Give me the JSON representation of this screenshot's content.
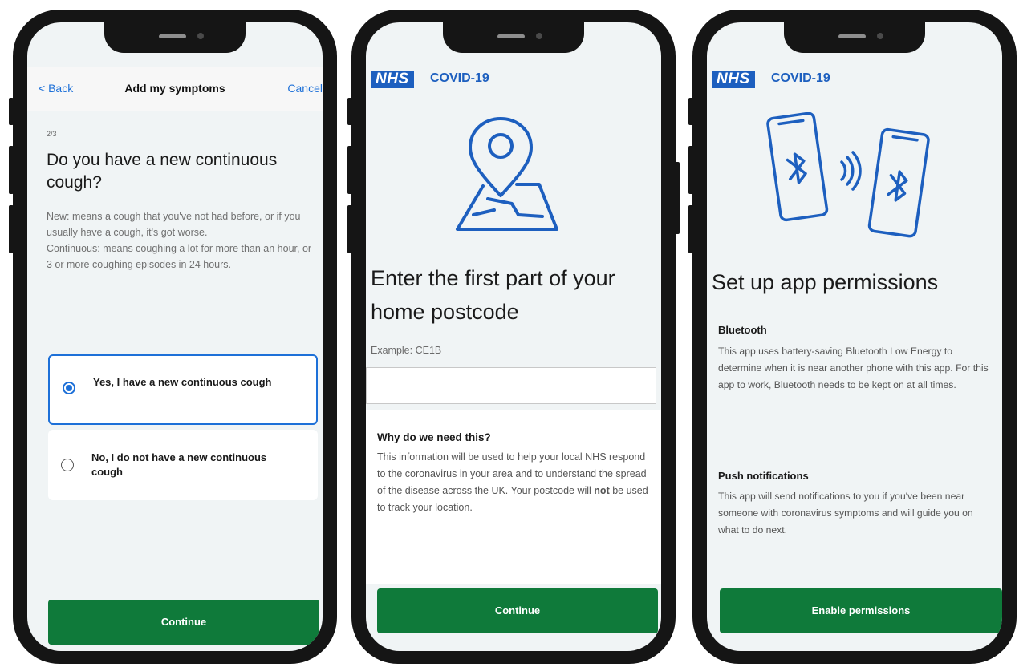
{
  "screen1": {
    "nav": {
      "back": "< Back",
      "title": "Add my symptoms",
      "cancel": "Cancel"
    },
    "step": "2/3",
    "question": "Do you have a new continuous cough?",
    "help_line1": "New: means a cough that you've not had before, or if you usually have a cough, it's got worse.",
    "help_line2": "Continuous: means coughing a lot for more than an hour, or 3 or more coughing episodes in 24 hours.",
    "options": [
      {
        "label": "Yes, I have a new continuous cough",
        "selected": true
      },
      {
        "label": "No, I do not have a new continuous cough",
        "selected": false
      }
    ],
    "continue": "Continue"
  },
  "screen2": {
    "logo": "NHS",
    "app_name": "COVID-19",
    "illustration_icon": "map-pin-icon",
    "heading": "Enter the first part of your home postcode",
    "example": "Example: CE1B",
    "postcode_value": "",
    "why_title": "Why do we need this?",
    "why_body_start": "This information will be used to help your local NHS respond to the coronavirus in your area and to understand the spread of the disease across the UK. Your postcode will ",
    "why_body_bold": "not",
    "why_body_end": " be used to track your location.",
    "continue": "Continue"
  },
  "screen3": {
    "logo": "NHS",
    "app_name": "COVID-19",
    "illustration_icon": "bluetooth-phones-icon",
    "heading": "Set up app permissions",
    "bluetooth_title": "Bluetooth",
    "bluetooth_body": "This app uses battery-saving Bluetooth Low Energy to determine when it is near another phone with this app. For this app to work, Bluetooth needs to be kept on at all times.",
    "push_title": "Push notifications",
    "push_body": "This app will send notifications to you if you've been near someone with coronavirus symptoms and will guide you on what to do next.",
    "enable": "Enable permissions"
  },
  "colors": {
    "nhs_blue": "#1d5fbf",
    "link_blue": "#1d70d8",
    "action_green": "#0f7a3a",
    "screen_bg": "#f0f4f5"
  }
}
